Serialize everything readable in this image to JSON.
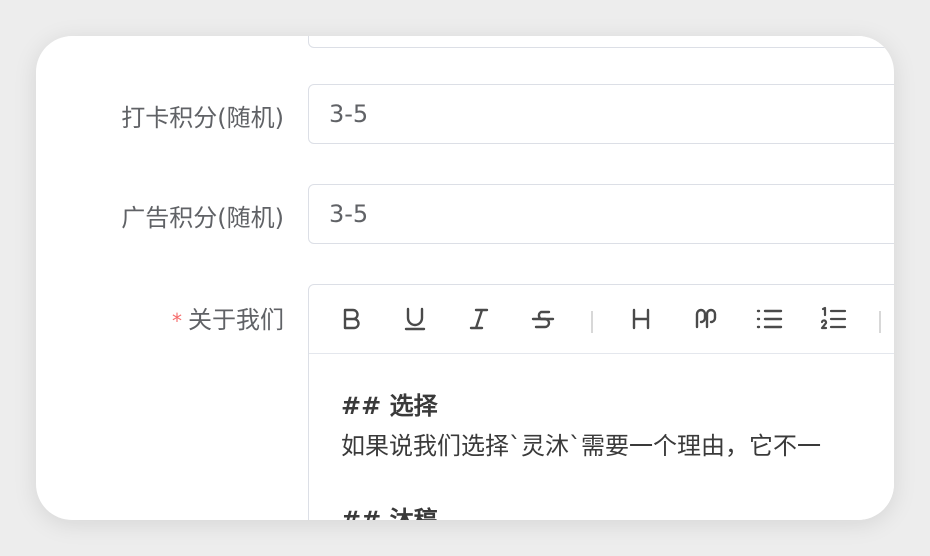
{
  "form": {
    "checkin_points": {
      "label": "打卡积分(随机)",
      "value": "3-5"
    },
    "ad_points": {
      "label": "广告积分(随机)",
      "value": "3-5"
    },
    "about_us": {
      "required_mark": "*",
      "label": "关于我们",
      "toolbar": [
        "bold-icon",
        "underline-icon",
        "italic-icon",
        "strikethrough-icon",
        "heading-icon",
        "quote-icon",
        "unordered-list-icon",
        "ordered-list-icon"
      ],
      "content": {
        "line1": "## 选择",
        "line2": "如果说我们选择`灵沐`需要一个理由，它不一",
        "line3": "## 沐稿"
      }
    }
  }
}
